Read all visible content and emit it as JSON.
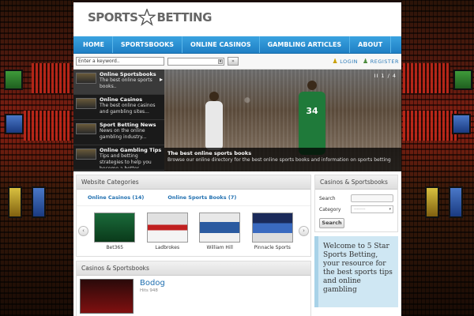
{
  "brand": {
    "logo_left": "SPORTS",
    "logo_right": "BETTING",
    "accent": "#2a8fd6"
  },
  "nav": {
    "items": [
      {
        "label": "HOME"
      },
      {
        "label": "SPORTSBOOKS"
      },
      {
        "label": "ONLINE CASINOS"
      },
      {
        "label": "GAMBLING ARTICLES"
      },
      {
        "label": "ABOUT"
      }
    ]
  },
  "search": {
    "placeholder": "Enter a keyword..",
    "go_label": "»"
  },
  "auth": {
    "login": "LOGIN",
    "register": "REGISTER"
  },
  "slider": {
    "counter": "II 1 / 4",
    "items": [
      {
        "title": "Online Sportsbooks",
        "text": "The best online sports books.."
      },
      {
        "title": "Online Casinos",
        "text": "The best online casinos and gambling sites..."
      },
      {
        "title": "Sport Betting News",
        "text": "News on the online gambling industry..."
      },
      {
        "title": "Online Gambling Tips",
        "text": "Tips and betting strategies to help you become a better..."
      }
    ],
    "caption_title": "The best online sports books",
    "caption_text": "Browse our online directory for the best online sports books and information on sports betting",
    "jersey_number": "34"
  },
  "categories": {
    "heading": "Website Categories",
    "links": [
      "Online Casinos (14)",
      "Online Sports Books (7)"
    ],
    "carousel": [
      "Bet365",
      "Ladbrokes",
      "William Hill",
      "Pinnacle Sports"
    ],
    "prev": "‹",
    "next": "›"
  },
  "featured": {
    "heading": "Casinos & Sportsbooks",
    "title": "Bodog",
    "hits": "Hits 948"
  },
  "sidebar": {
    "heading": "Casinos & Sportsbooks",
    "search_label": "Search",
    "category_label": "Category",
    "category_value": "--------",
    "button": "Search",
    "welcome": "Welcome to 5 Star Sports Betting, your resource for the best sports tips and online gambling"
  }
}
